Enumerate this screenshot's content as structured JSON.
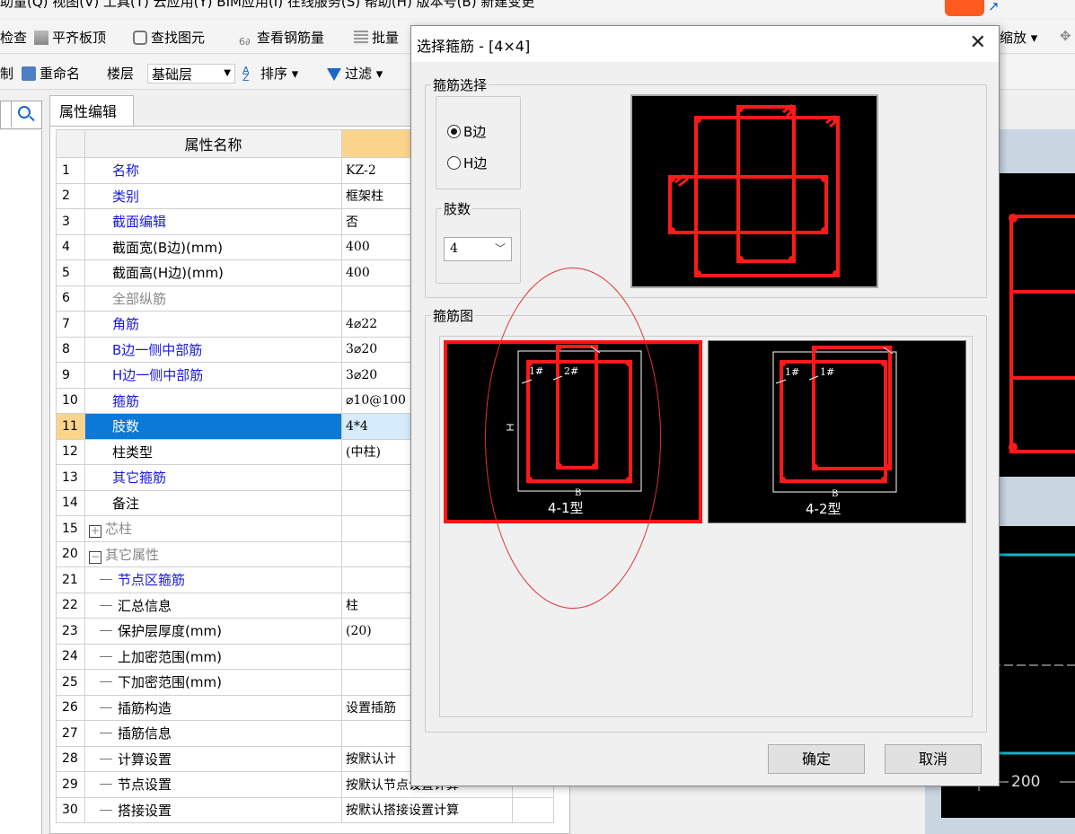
{
  "menubar": {
    "text": "助量(Q)  视图(V)  工具(T)  云应用(Y)  BIM应用(I)  在线服务(S)  帮助(H)  版本号(B)  新建变更"
  },
  "toolbar1": {
    "check": "检查",
    "flat_top": "平齐板顶",
    "find_element": "查找图元",
    "view_rebar": "查看钢筋量",
    "batch": "批量",
    "zoom": "缩放"
  },
  "toolbar2": {
    "copy_tail": "制",
    "rename": "重命名",
    "floor_label": "楼层",
    "floor_value": "基础层",
    "sort": "排序",
    "filter": "过滤"
  },
  "property_panel": {
    "tab": "属性编辑",
    "header_name": "属性名称",
    "header_value": "属",
    "rows": [
      {
        "num": "1",
        "name": "名称",
        "value": "KZ-2",
        "style": "blue"
      },
      {
        "num": "2",
        "name": "类别",
        "value": "框架柱",
        "style": "blue"
      },
      {
        "num": "3",
        "name": "截面编辑",
        "value": "否",
        "style": "blue"
      },
      {
        "num": "4",
        "name": "截面宽(B边)(mm)",
        "value": "400",
        "style": "black"
      },
      {
        "num": "5",
        "name": "截面高(H边)(mm)",
        "value": "400",
        "style": "black"
      },
      {
        "num": "6",
        "name": "全部纵筋",
        "value": "",
        "style": "gray"
      },
      {
        "num": "7",
        "name": "角筋",
        "value": "4⌀22",
        "style": "blue"
      },
      {
        "num": "8",
        "name": "B边一侧中部筋",
        "value": "3⌀20",
        "style": "blue"
      },
      {
        "num": "9",
        "name": "H边一侧中部筋",
        "value": "3⌀20",
        "style": "blue"
      },
      {
        "num": "10",
        "name": "箍筋",
        "value": "⌀10@100",
        "style": "blue"
      },
      {
        "num": "11",
        "name": "肢数",
        "value": "4*4",
        "style": "blue"
      },
      {
        "num": "12",
        "name": "柱类型",
        "value": "(中柱)",
        "style": "black"
      },
      {
        "num": "13",
        "name": "其它箍筋",
        "value": "",
        "style": "blue"
      },
      {
        "num": "14",
        "name": "备注",
        "value": "",
        "style": "black"
      },
      {
        "num": "15",
        "name": "芯柱",
        "value": "",
        "style": "gray"
      },
      {
        "num": "20",
        "name": "其它属性",
        "value": "",
        "style": "gray"
      },
      {
        "num": "21",
        "name": "节点区箍筋",
        "value": "",
        "style": "blue"
      },
      {
        "num": "22",
        "name": "汇总信息",
        "value": "柱",
        "style": "black"
      },
      {
        "num": "23",
        "name": "保护层厚度(mm)",
        "value": "(20)",
        "style": "black"
      },
      {
        "num": "24",
        "name": "上加密范围(mm)",
        "value": "",
        "style": "black"
      },
      {
        "num": "25",
        "name": "下加密范围(mm)",
        "value": "",
        "style": "black"
      },
      {
        "num": "26",
        "name": "插筋构造",
        "value": "设置插筋",
        "style": "black"
      },
      {
        "num": "27",
        "name": "插筋信息",
        "value": "",
        "style": "black"
      },
      {
        "num": "28",
        "name": "计算设置",
        "value": "按默认计",
        "style": "black"
      },
      {
        "num": "29",
        "name": "节点设置",
        "value": "按默认节点设置计算",
        "style": "black"
      },
      {
        "num": "30",
        "name": "搭接设置",
        "value": "按默认搭接设置计算",
        "style": "black"
      }
    ]
  },
  "dialog": {
    "title": "选择箍筋 - [4×4]",
    "stirrup_select_legend": "箍筋选择",
    "radio_b": "B边",
    "radio_h": "H边",
    "limbs_legend": "肢数",
    "limbs_value": "4",
    "diagram_legend": "箍筋图",
    "type1_label": "4-1型",
    "type2_label": "4-2型",
    "b_letter": "B",
    "h_letter": "H",
    "tag_1": "1#",
    "tag_2": "2#",
    "ok": "确定",
    "cancel": "取消"
  },
  "canvas": {
    "dimension_label": "200"
  },
  "colors": {
    "selection": "#0a79d8",
    "header_accent": "#fbd48c",
    "rebar_red": "#ff1a1a",
    "blue_text": "#1a1adc"
  }
}
